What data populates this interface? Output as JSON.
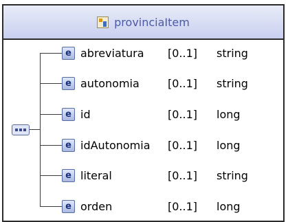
{
  "complex_type": {
    "name": "provinciaItem",
    "icon": "complex-type-icon"
  },
  "compositor": {
    "icon": "sequence-icon"
  },
  "elements": [
    {
      "badge": "e",
      "name": "abreviatura",
      "multiplicity": "[0..1]",
      "type": "string"
    },
    {
      "badge": "e",
      "name": "autonomia",
      "multiplicity": "[0..1]",
      "type": "string"
    },
    {
      "badge": "e",
      "name": "id",
      "multiplicity": "[0..1]",
      "type": "long"
    },
    {
      "badge": "e",
      "name": "idAutonomia",
      "multiplicity": "[0..1]",
      "type": "long"
    },
    {
      "badge": "e",
      "name": "literal",
      "multiplicity": "[0..1]",
      "type": "string"
    },
    {
      "badge": "e",
      "name": "orden",
      "multiplicity": "[0..1]",
      "type": "long"
    }
  ],
  "colors": {
    "header_gradient_top": "#e8ecf8",
    "header_gradient_bottom": "#c9cff0",
    "title_text": "#4a5aa5",
    "element_badge_text": "#1a2f7a"
  }
}
